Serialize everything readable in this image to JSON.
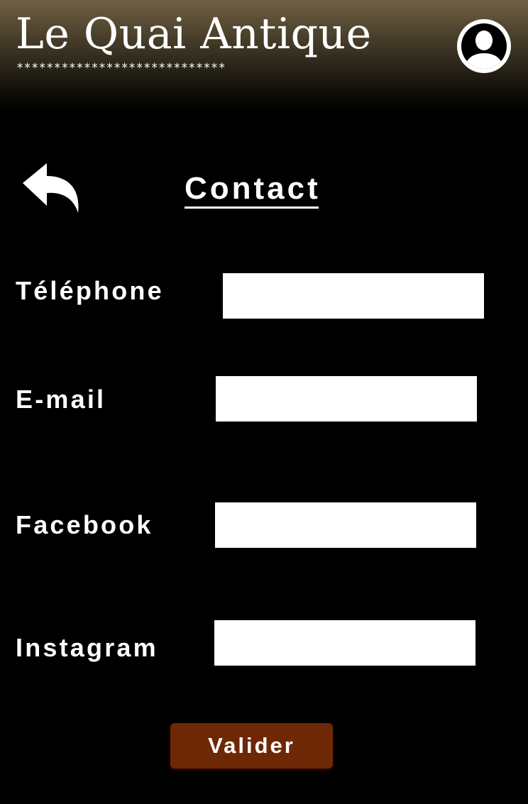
{
  "header": {
    "brand_title": "Le Quai Antique",
    "brand_decoration": "****************************",
    "account_icon": "user-avatar-icon"
  },
  "nav": {
    "back_icon": "reply-arrow-icon"
  },
  "page": {
    "title": "Contact"
  },
  "form": {
    "fields": [
      {
        "label": "Téléphone",
        "value": ""
      },
      {
        "label": "E-mail",
        "value": ""
      },
      {
        "label": "Facebook",
        "value": ""
      },
      {
        "label": "Instagram",
        "value": ""
      }
    ],
    "submit_label": "Valider"
  },
  "colors": {
    "background": "#000000",
    "header_gradient_top": "#6f6042",
    "button": "#6e2806",
    "text": "#ffffff"
  }
}
